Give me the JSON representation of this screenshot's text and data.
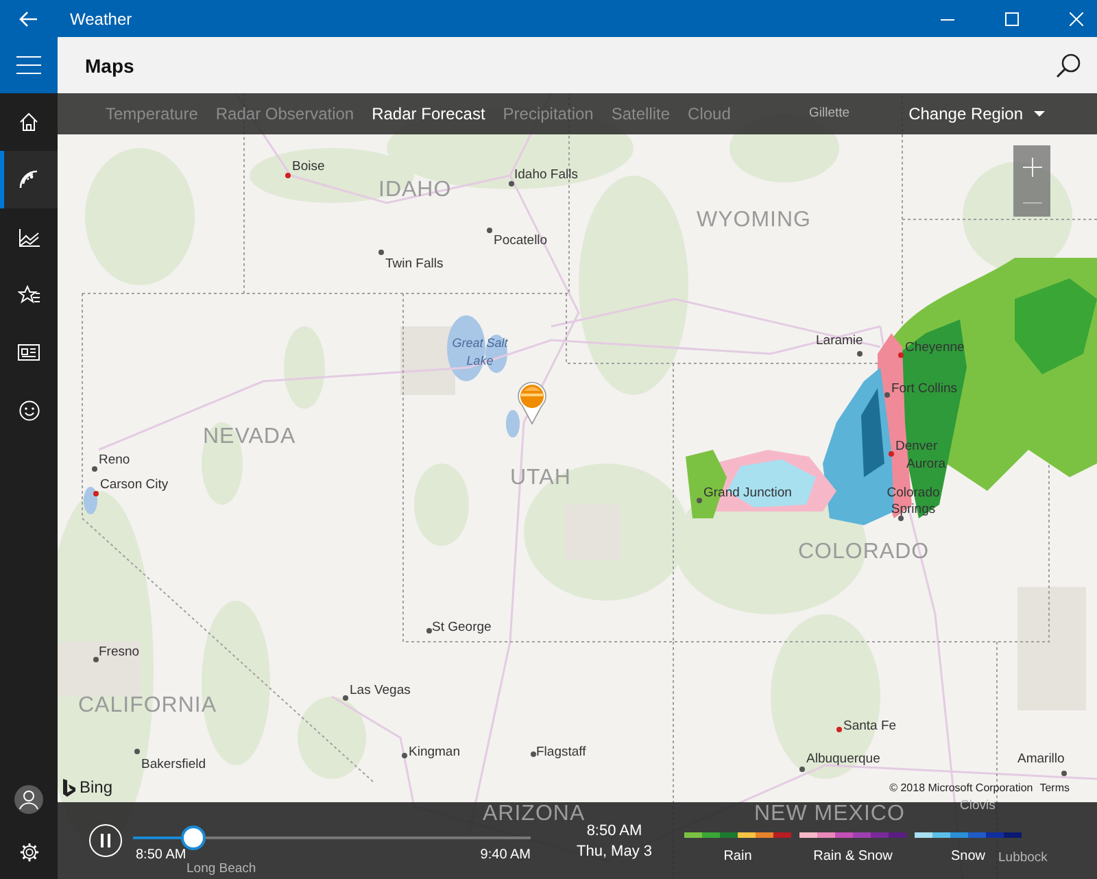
{
  "window": {
    "title": "Weather"
  },
  "nav_items": [
    {
      "selected": false
    },
    {
      "selected": true
    },
    {
      "selected": false
    },
    {
      "selected": false
    },
    {
      "selected": false
    },
    {
      "selected": false
    }
  ],
  "page_title": "Maps",
  "tabs": [
    {
      "label": "Temperature",
      "selected": false
    },
    {
      "label": "Radar Observation",
      "selected": false
    },
    {
      "label": "Radar Forecast",
      "selected": true
    },
    {
      "label": "Precipitation",
      "selected": false
    },
    {
      "label": "Satellite",
      "selected": false
    },
    {
      "label": "Cloud",
      "selected": false
    }
  ],
  "change_region": "Change Region",
  "map": {
    "labels": [
      {
        "text": "Boise",
        "kind": "capital"
      },
      {
        "text": "IDAHO",
        "kind": "state"
      },
      {
        "text": "Idaho Falls",
        "kind": "city"
      },
      {
        "text": "Pocatello",
        "kind": "city"
      },
      {
        "text": "Twin Falls",
        "kind": "city"
      },
      {
        "text": "WYOMING",
        "kind": "state"
      },
      {
        "text": "Great Salt Lake",
        "kind": "water"
      },
      {
        "text": "NEVADA",
        "kind": "state"
      },
      {
        "text": "Reno",
        "kind": "city"
      },
      {
        "text": "Carson City",
        "kind": "capital"
      },
      {
        "text": "UTAH",
        "kind": "state"
      },
      {
        "text": "Laramie",
        "kind": "city"
      },
      {
        "text": "Cheyenne",
        "kind": "capital"
      },
      {
        "text": "Fort Collins",
        "kind": "city"
      },
      {
        "text": "Denver",
        "kind": "capital"
      },
      {
        "text": "Aurora",
        "kind": "city"
      },
      {
        "text": "Grand Junction",
        "kind": "city"
      },
      {
        "text": "Colorado Springs",
        "kind": "city"
      },
      {
        "text": "COLORADO",
        "kind": "state"
      },
      {
        "text": "St George",
        "kind": "city"
      },
      {
        "text": "Fresno",
        "kind": "city"
      },
      {
        "text": "CALIFORNIA",
        "kind": "state"
      },
      {
        "text": "Las Vegas",
        "kind": "city"
      },
      {
        "text": "Kingman",
        "kind": "city"
      },
      {
        "text": "Flagstaff",
        "kind": "city"
      },
      {
        "text": "Santa Fe",
        "kind": "capital"
      },
      {
        "text": "Albuquerque",
        "kind": "city"
      },
      {
        "text": "Amarillo",
        "kind": "city"
      },
      {
        "text": "Bakersfield",
        "kind": "city"
      },
      {
        "text": "Gillette",
        "kind": "city"
      },
      {
        "text": "ARIZONA",
        "kind": "state"
      },
      {
        "text": "NEW MEXICO",
        "kind": "state"
      },
      {
        "text": "Clovis",
        "kind": "city"
      },
      {
        "text": "Lubbock",
        "kind": "city"
      },
      {
        "text": "Long Beach",
        "kind": "city"
      }
    ],
    "brand": "Bing",
    "copyright": "© 2018 Microsoft Corporation",
    "terms": "Terms"
  },
  "player": {
    "playing": true,
    "level": 0.15,
    "start": "8:50 AM",
    "end": "9:40 AM",
    "time": "8:50 AM",
    "date": "Thu, May 3"
  },
  "legend": [
    {
      "label": "Rain",
      "colors": [
        {
          "color": "#7cc242"
        },
        {
          "color": "#3aa635"
        },
        {
          "color": "#1c7a2e"
        },
        {
          "color": "#f5c344"
        },
        {
          "color": "#e8822b"
        },
        {
          "color": "#b81d24"
        }
      ]
    },
    {
      "label": "Rain & Snow",
      "colors": [
        {
          "color": "#f6b8c8"
        },
        {
          "color": "#e987b8"
        },
        {
          "color": "#c44fb5"
        },
        {
          "color": "#a040b0"
        },
        {
          "color": "#7a2a9a"
        },
        {
          "color": "#5a1e80"
        }
      ]
    },
    {
      "label": "Snow",
      "colors": [
        {
          "color": "#a8e0f0"
        },
        {
          "color": "#5bc0e8"
        },
        {
          "color": "#2b8fd6"
        },
        {
          "color": "#1e5cc8"
        },
        {
          "color": "#102e9e"
        },
        {
          "color": "#0a1a70"
        }
      ]
    }
  ]
}
